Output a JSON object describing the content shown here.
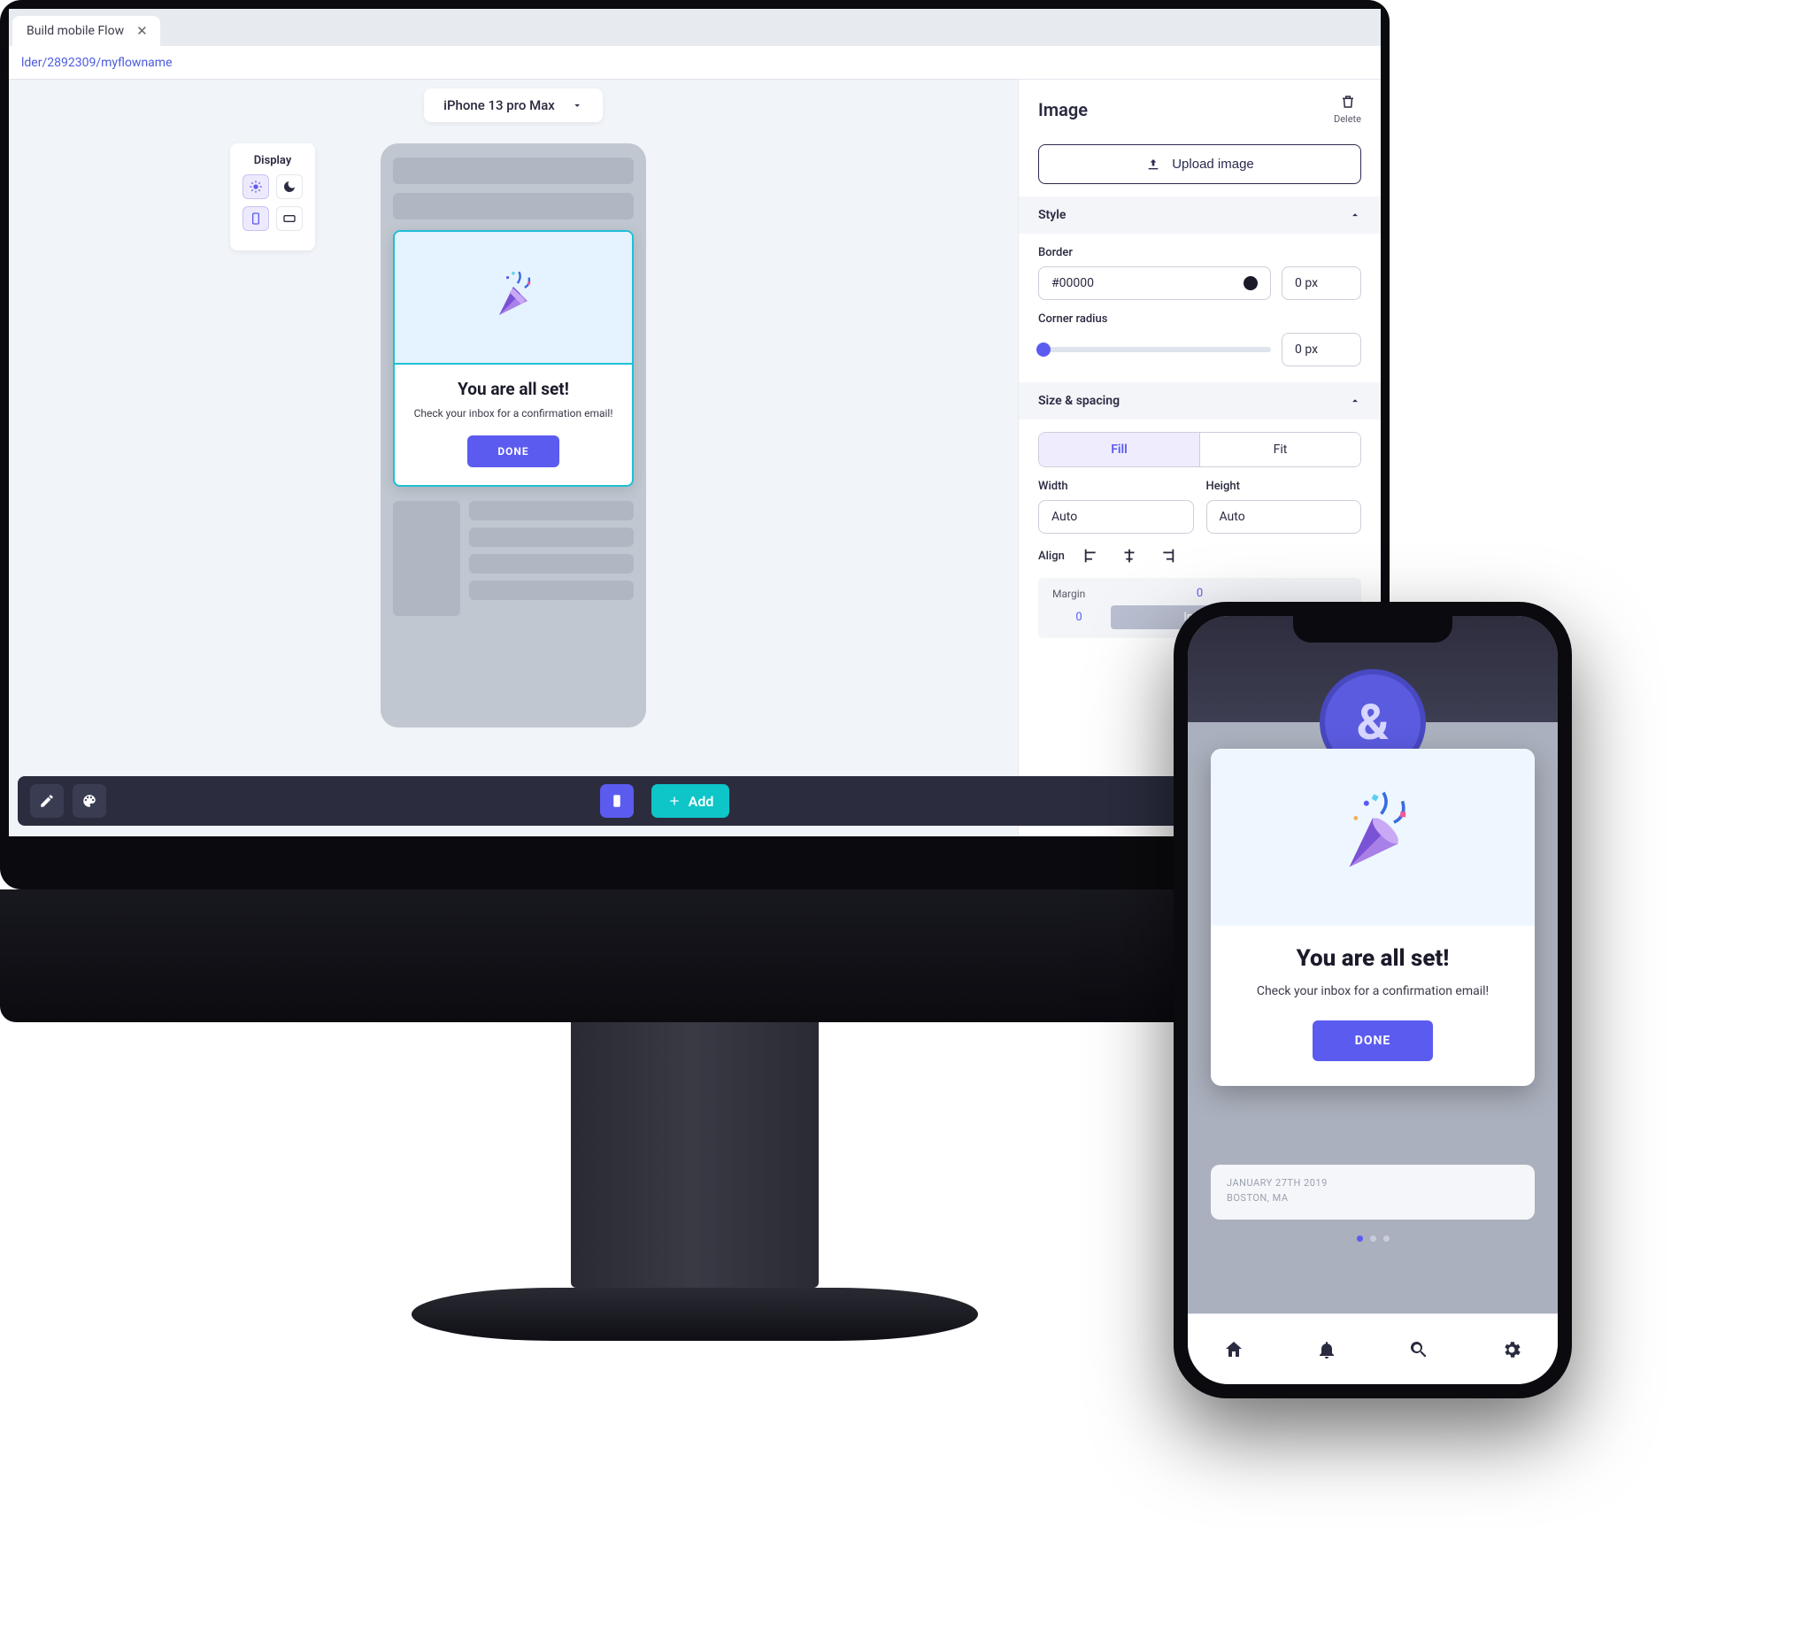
{
  "browser": {
    "tab_title": "Build mobile Flow",
    "url": "lder/2892309/myflowname"
  },
  "builder": {
    "device_selector": "iPhone 13 pro Max",
    "display_label": "Display",
    "preview_modal": {
      "title": "You are all set!",
      "body": "Check your inbox for a confirmation email!",
      "button": "DONE"
    }
  },
  "inspector": {
    "title": "Image",
    "delete_label": "Delete",
    "upload_label": "Upload image",
    "style": {
      "section_label": "Style",
      "border_label": "Border",
      "border_color": "#00000",
      "border_width": "0 px",
      "corner_radius_label": "Corner radius",
      "corner_radius": "0 px"
    },
    "size": {
      "section_label": "Size & spacing",
      "fill": "Fill",
      "fit": "Fit",
      "width_label": "Width",
      "width_value": "Auto",
      "height_label": "Height",
      "height_value": "Auto",
      "align_label": "Align",
      "margin_label": "Margin",
      "margin_top": "0",
      "margin_left": "0",
      "margin_chip": "Image"
    }
  },
  "bottom_bar": {
    "add_label": "Add"
  },
  "phone": {
    "logo_glyph": "&",
    "modal": {
      "title": "You are all set!",
      "body": "Check your inbox for a confirmation email!",
      "button": "DONE"
    },
    "card_behind": {
      "line1": "JANUARY 27TH 2019",
      "line2": "BOSTON, MA"
    }
  }
}
